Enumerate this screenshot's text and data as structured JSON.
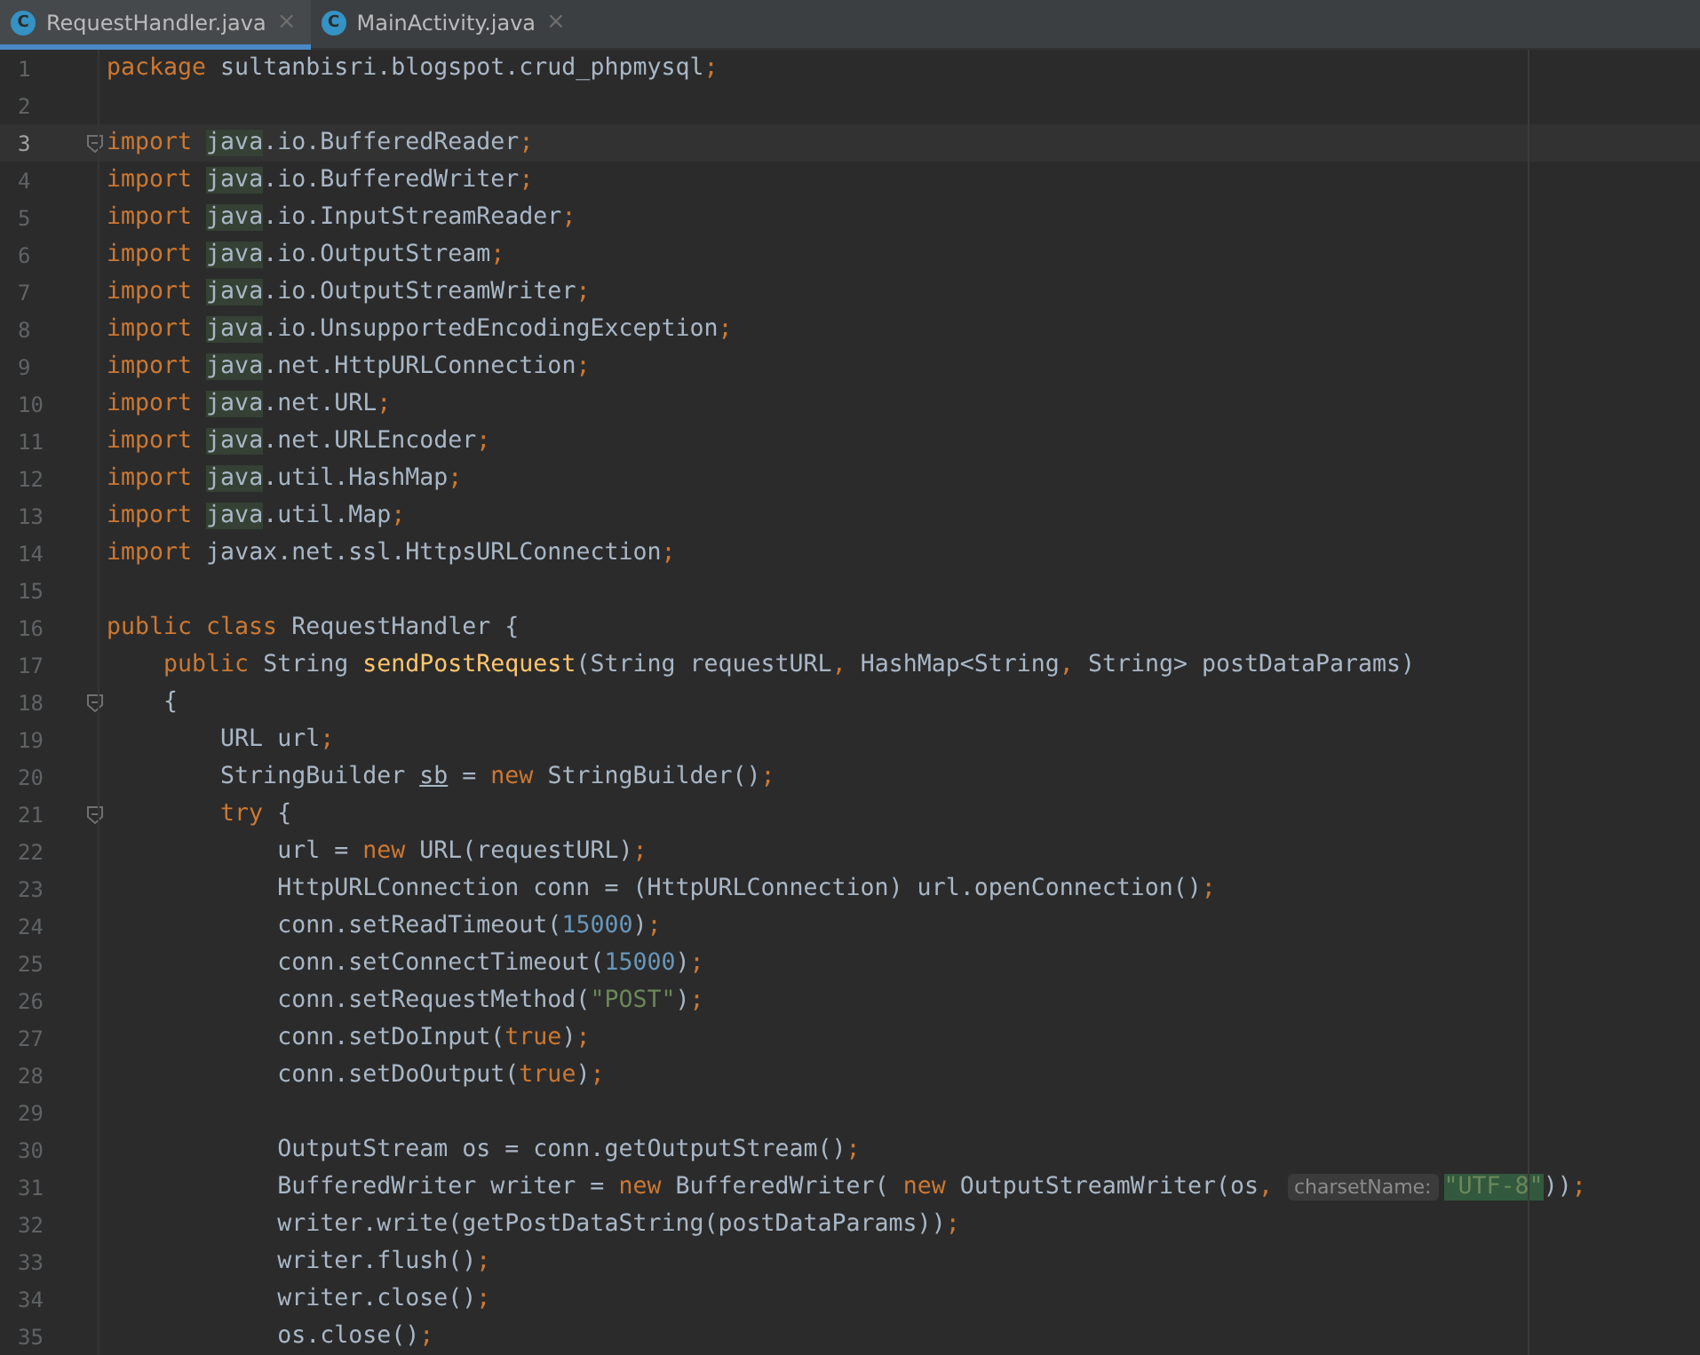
{
  "tabs": [
    {
      "icon_letter": "C",
      "label": "RequestHandler.java",
      "close": "×",
      "selected": true
    },
    {
      "icon_letter": "C",
      "label": "MainActivity.java",
      "close": "×",
      "selected": false
    }
  ],
  "editor": {
    "lines": [
      {
        "number": "1",
        "current": false,
        "fold": false,
        "tokens": [
          {
            "kind": "kw",
            "text": "package"
          },
          {
            "kind": "plain",
            "text": " sultanbisri.blogspot.crud_phpmysql"
          },
          {
            "kind": "kw",
            "text": ";"
          }
        ]
      },
      {
        "number": "2",
        "current": false,
        "fold": false
      },
      {
        "number": "3",
        "current": true,
        "fold": true,
        "tokens": [
          {
            "kind": "kw",
            "text": "import "
          },
          {
            "kind": "match",
            "text": "java"
          },
          {
            "kind": "plain",
            "text": ".io.BufferedReader"
          },
          {
            "kind": "kw",
            "text": ";"
          }
        ]
      },
      {
        "number": "4",
        "current": false,
        "fold": false,
        "tokens": [
          {
            "kind": "kw",
            "text": "import "
          },
          {
            "kind": "match",
            "text": "java"
          },
          {
            "kind": "plain",
            "text": ".io.BufferedWriter"
          },
          {
            "kind": "kw",
            "text": ";"
          }
        ]
      },
      {
        "number": "5",
        "current": false,
        "fold": false,
        "tokens": [
          {
            "kind": "kw",
            "text": "import "
          },
          {
            "kind": "match",
            "text": "java"
          },
          {
            "kind": "plain",
            "text": ".io.InputStreamReader"
          },
          {
            "kind": "kw",
            "text": ";"
          }
        ]
      },
      {
        "number": "6",
        "current": false,
        "fold": false,
        "tokens": [
          {
            "kind": "kw",
            "text": "import "
          },
          {
            "kind": "match",
            "text": "java"
          },
          {
            "kind": "plain",
            "text": ".io.OutputStream"
          },
          {
            "kind": "kw",
            "text": ";"
          }
        ]
      },
      {
        "number": "7",
        "current": false,
        "fold": false,
        "tokens": [
          {
            "kind": "kw",
            "text": "import "
          },
          {
            "kind": "match",
            "text": "java"
          },
          {
            "kind": "plain",
            "text": ".io.OutputStreamWriter"
          },
          {
            "kind": "kw",
            "text": ";"
          }
        ]
      },
      {
        "number": "8",
        "current": false,
        "fold": false,
        "tokens": [
          {
            "kind": "kw",
            "text": "import "
          },
          {
            "kind": "match",
            "text": "java"
          },
          {
            "kind": "plain",
            "text": ".io.UnsupportedEncodingException"
          },
          {
            "kind": "kw",
            "text": ";"
          }
        ]
      },
      {
        "number": "9",
        "current": false,
        "fold": false,
        "tokens": [
          {
            "kind": "kw",
            "text": "import "
          },
          {
            "kind": "match",
            "text": "java"
          },
          {
            "kind": "plain",
            "text": ".net.HttpURLConnection"
          },
          {
            "kind": "kw",
            "text": ";"
          }
        ]
      },
      {
        "number": "10",
        "current": false,
        "fold": false,
        "tokens": [
          {
            "kind": "kw",
            "text": "import "
          },
          {
            "kind": "match",
            "text": "java"
          },
          {
            "kind": "plain",
            "text": ".net.URL"
          },
          {
            "kind": "kw",
            "text": ";"
          }
        ]
      },
      {
        "number": "11",
        "current": false,
        "fold": false,
        "tokens": [
          {
            "kind": "kw",
            "text": "import "
          },
          {
            "kind": "match",
            "text": "java"
          },
          {
            "kind": "plain",
            "text": ".net.URLEncoder"
          },
          {
            "kind": "kw",
            "text": ";"
          }
        ]
      },
      {
        "number": "12",
        "current": false,
        "fold": false,
        "tokens": [
          {
            "kind": "kw",
            "text": "import "
          },
          {
            "kind": "match",
            "text": "java"
          },
          {
            "kind": "plain",
            "text": ".util.HashMap"
          },
          {
            "kind": "kw",
            "text": ";"
          }
        ]
      },
      {
        "number": "13",
        "current": false,
        "fold": false,
        "tokens": [
          {
            "kind": "kw",
            "text": "import "
          },
          {
            "kind": "match",
            "text": "java"
          },
          {
            "kind": "plain",
            "text": ".util.Map"
          },
          {
            "kind": "kw",
            "text": ";"
          }
        ]
      },
      {
        "number": "14",
        "current": false,
        "fold": false,
        "tokens": [
          {
            "kind": "kw",
            "text": "import"
          },
          {
            "kind": "plain",
            "text": " javax.net.ssl.HttpsURLConnection"
          },
          {
            "kind": "kw",
            "text": ";"
          }
        ]
      },
      {
        "number": "15",
        "current": false,
        "fold": false
      },
      {
        "number": "16",
        "current": false,
        "fold": false,
        "tokens": [
          {
            "kind": "kw",
            "text": "public class"
          },
          {
            "kind": "plain",
            "text": " RequestHandler {"
          }
        ]
      },
      {
        "number": "17",
        "current": false,
        "fold": false,
        "tokens": [
          {
            "kind": "kw",
            "text": "    public"
          },
          {
            "kind": "plain",
            "text": " String "
          },
          {
            "kind": "method",
            "text": "sendPostRequest"
          },
          {
            "kind": "plain",
            "text": "(String requestURL"
          },
          {
            "kind": "kw",
            "text": ","
          },
          {
            "kind": "plain",
            "text": " HashMap<String"
          },
          {
            "kind": "kw",
            "text": ","
          },
          {
            "kind": "plain",
            "text": " String> postDataParams)"
          }
        ]
      },
      {
        "number": "18",
        "current": false,
        "fold": true,
        "tokens": [
          {
            "kind": "plain",
            "text": "    {"
          }
        ]
      },
      {
        "number": "19",
        "current": false,
        "fold": false,
        "tokens": [
          {
            "kind": "plain",
            "text": "        URL url"
          },
          {
            "kind": "kw",
            "text": ";"
          }
        ]
      },
      {
        "number": "20",
        "current": false,
        "fold": false,
        "tokens": [
          {
            "kind": "plain",
            "text": "        StringBuilder "
          },
          {
            "kind": "under",
            "text": "sb"
          },
          {
            "kind": "plain",
            "text": " = "
          },
          {
            "kind": "kw",
            "text": "new"
          },
          {
            "kind": "plain",
            "text": " StringBuilder()"
          },
          {
            "kind": "kw",
            "text": ";"
          }
        ]
      },
      {
        "number": "21",
        "current": false,
        "fold": true,
        "tokens": [
          {
            "kind": "kw",
            "text": "        try"
          },
          {
            "kind": "plain",
            "text": " {"
          }
        ]
      },
      {
        "number": "22",
        "current": false,
        "fold": false,
        "tokens": [
          {
            "kind": "plain",
            "text": "            url = "
          },
          {
            "kind": "kw",
            "text": "new"
          },
          {
            "kind": "plain",
            "text": " URL(requestURL)"
          },
          {
            "kind": "kw",
            "text": ";"
          }
        ]
      },
      {
        "number": "23",
        "current": false,
        "fold": false,
        "tokens": [
          {
            "kind": "plain",
            "text": "            HttpURLConnection conn = (HttpURLConnection) url.openConnection()"
          },
          {
            "kind": "kw",
            "text": ";"
          }
        ]
      },
      {
        "number": "24",
        "current": false,
        "fold": false,
        "tokens": [
          {
            "kind": "plain",
            "text": "            conn.setReadTimeout("
          },
          {
            "kind": "num",
            "text": "15000"
          },
          {
            "kind": "plain",
            "text": ")"
          },
          {
            "kind": "kw",
            "text": ";"
          }
        ]
      },
      {
        "number": "25",
        "current": false,
        "fold": false,
        "tokens": [
          {
            "kind": "plain",
            "text": "            conn.setConnectTimeout("
          },
          {
            "kind": "num",
            "text": "15000"
          },
          {
            "kind": "plain",
            "text": ")"
          },
          {
            "kind": "kw",
            "text": ";"
          }
        ]
      },
      {
        "number": "26",
        "current": false,
        "fold": false,
        "tokens": [
          {
            "kind": "plain",
            "text": "            conn.setRequestMethod("
          },
          {
            "kind": "str",
            "text": "\"POST\""
          },
          {
            "kind": "plain",
            "text": ")"
          },
          {
            "kind": "kw",
            "text": ";"
          }
        ]
      },
      {
        "number": "27",
        "current": false,
        "fold": false,
        "tokens": [
          {
            "kind": "plain",
            "text": "            conn.setDoInput("
          },
          {
            "kind": "kw",
            "text": "true"
          },
          {
            "kind": "plain",
            "text": ")"
          },
          {
            "kind": "kw",
            "text": ";"
          }
        ]
      },
      {
        "number": "28",
        "current": false,
        "fold": false,
        "tokens": [
          {
            "kind": "plain",
            "text": "            conn.setDoOutput("
          },
          {
            "kind": "kw",
            "text": "true"
          },
          {
            "kind": "plain",
            "text": ")"
          },
          {
            "kind": "kw",
            "text": ";"
          }
        ]
      },
      {
        "number": "29",
        "current": false,
        "fold": false
      },
      {
        "number": "30",
        "current": false,
        "fold": false,
        "tokens": [
          {
            "kind": "plain",
            "text": "            OutputStream os = conn.getOutputStream()"
          },
          {
            "kind": "kw",
            "text": ";"
          }
        ]
      },
      {
        "number": "31",
        "current": false,
        "fold": false,
        "tokens": [
          {
            "kind": "plain",
            "text": "            BufferedWriter writer = "
          },
          {
            "kind": "kw",
            "text": "new"
          },
          {
            "kind": "plain",
            "text": " BufferedWriter( "
          },
          {
            "kind": "kw",
            "text": "new"
          },
          {
            "kind": "plain",
            "text": " OutputStreamWriter(os"
          },
          {
            "kind": "kw",
            "text": ", "
          },
          {
            "kind": "hint",
            "text": "charsetName:"
          },
          {
            "kind": "str-match",
            "text": "\"UTF-8\""
          },
          {
            "kind": "plain",
            "text": "))"
          },
          {
            "kind": "kw",
            "text": ";"
          }
        ]
      },
      {
        "number": "32",
        "current": false,
        "fold": false,
        "tokens": [
          {
            "kind": "plain",
            "text": "            writer.write(getPostDataString(postDataParams))"
          },
          {
            "kind": "kw",
            "text": ";"
          }
        ]
      },
      {
        "number": "33",
        "current": false,
        "fold": false,
        "tokens": [
          {
            "kind": "plain",
            "text": "            writer.flush()"
          },
          {
            "kind": "kw",
            "text": ";"
          }
        ]
      },
      {
        "number": "34",
        "current": false,
        "fold": false,
        "tokens": [
          {
            "kind": "plain",
            "text": "            writer.close()"
          },
          {
            "kind": "kw",
            "text": ";"
          }
        ]
      },
      {
        "number": "35",
        "current": false,
        "fold": false,
        "tokens": [
          {
            "kind": "plain",
            "text": "            os.close()"
          },
          {
            "kind": "kw",
            "text": ";"
          }
        ]
      }
    ]
  }
}
